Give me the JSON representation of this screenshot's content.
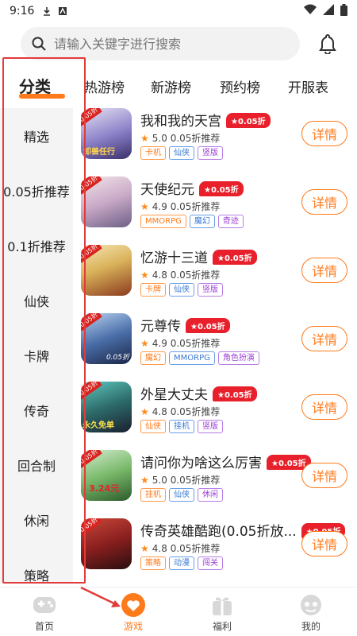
{
  "status": {
    "time": "9:16"
  },
  "search": {
    "placeholder": "请输入关键字进行搜索"
  },
  "tabs": [
    "分类",
    "热游榜",
    "新游榜",
    "预约榜",
    "开服表"
  ],
  "sidebar": [
    "精选",
    "0.05折推荐",
    "0.1折推荐",
    "仙侠",
    "卡牌",
    "传奇",
    "回合制",
    "休闲",
    "策略"
  ],
  "games": [
    {
      "name": "我和我的天宫",
      "discount": "★0.05折",
      "rating": "5.0",
      "recommend": "0.05折推荐",
      "tags": [
        "卡机",
        "仙侠",
        "竖版"
      ],
      "badge": "0.05折",
      "cover": "卸兽任行",
      "detail": "详情"
    },
    {
      "name": "天使纪元",
      "discount": "★0.05折",
      "rating": "4.9",
      "recommend": "0.05折推荐",
      "tags": [
        "MMORPG",
        "魔幻",
        "奇迹"
      ],
      "badge": "0.05折",
      "cover": "",
      "detail": "详情"
    },
    {
      "name": "忆游十三道",
      "discount": "★0.05折",
      "rating": "4.8",
      "recommend": "0.05折推荐",
      "tags": [
        "卡牌",
        "仙侠",
        "竖版"
      ],
      "badge": "0.05折",
      "cover": "",
      "detail": "详情"
    },
    {
      "name": "元尊传",
      "discount": "★0.05折",
      "rating": "4.9",
      "recommend": "0.05折推荐",
      "tags": [
        "魔幻",
        "MMORPG",
        "角色扮演"
      ],
      "badge": "0.05折",
      "cover": "0.05折",
      "detail": "详情"
    },
    {
      "name": "外星大丈夫",
      "discount": "★0.05折",
      "rating": "4.8",
      "recommend": "0.05折推荐",
      "tags": [
        "仙侠",
        "挂机",
        "竖版"
      ],
      "badge": "0.05折",
      "cover": "永久免单",
      "detail": "详情"
    },
    {
      "name": "请问你为啥这么厉害",
      "discount": "★0.05折",
      "rating": "5.0",
      "recommend": "0.05折推荐",
      "tags": [
        "挂机",
        "仙侠",
        "休闲"
      ],
      "badge": "0.05折",
      "cover": "3.24元",
      "detail": "详情"
    },
    {
      "name": "传奇英雄酷跑(0.05折放...",
      "discount": "★0.05折",
      "rating": "4.8",
      "recommend": "0.05折推荐",
      "tags": [
        "策略",
        "动漫",
        "闯关"
      ],
      "badge": "0.05折",
      "cover": "",
      "detail": "详情"
    }
  ],
  "nav": [
    "首页",
    "游戏",
    "福利",
    "我的"
  ],
  "colors": {
    "accent": "#ff7a1a",
    "discount": "#e8202b",
    "highlight_box": "#e23b3b"
  }
}
